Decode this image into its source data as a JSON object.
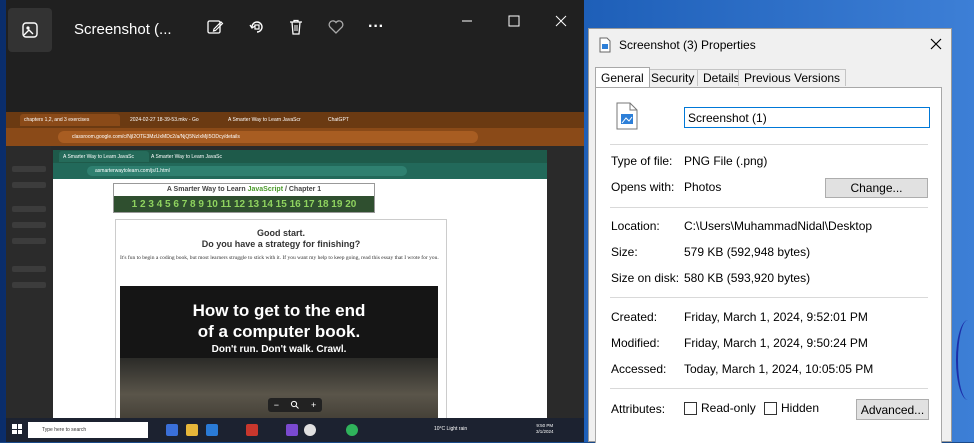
{
  "photos": {
    "title": "Screenshot (...",
    "toolbar_icons": [
      "edit-icon",
      "rotate-icon",
      "delete-icon",
      "favorite-icon",
      "more-icon"
    ],
    "more_label": "···"
  },
  "shot": {
    "browser_tabs": [
      "chapters 1,2, and 3 exercises",
      "2024-02-27 18-39-53.mkv - Go",
      "A Smarter Way to Learn JavaScr",
      "ChatGPT"
    ],
    "browser_url": "classroom.google.com/c/NjI2OTE3MzUxMDc2/a/NjQ5NzIxMjI5ODcy/details",
    "popup_tabs": [
      "A Smarter Way to Learn JavaSc",
      "A Smarter Way to Learn JavaSc"
    ],
    "popup_url": "asmarterwaytolearn.com/js/1.html",
    "header_prefix": "A Smarter Way to Learn",
    "header_js": "JavaScript",
    "header_suffix": " /  Chapter 1",
    "chapter_numbers": "1 2 3 4 5 6 7 8 9 10 11 12 13 14 15 16 17 18 19 20",
    "good_start": "Good start.",
    "strategy": "Do you have a strategy for finishing?",
    "intro": "It's fun to begin a coding book, but most learners struggle to stick with it. If you want my help to keep going, read this essay that I wrote for you.",
    "hero_title_1": "How to get to the end",
    "hero_title_2": "of a computer book.",
    "hero_sub": "Don't run. Don't walk. Crawl.",
    "zoom_minus": "−",
    "zoom_plus": "+",
    "taskbar_search": "Type here to search",
    "weather": "10°C  Light rain",
    "clock_time": "9:50 PM",
    "clock_date": "3/1/2024"
  },
  "props": {
    "title": "Screenshot (3) Properties",
    "tabs": [
      "General",
      "Security",
      "Details",
      "Previous Versions"
    ],
    "file_name": "Screenshot (1)",
    "type_label": "Type of file:",
    "type_value": "PNG File (.png)",
    "opens_label": "Opens with:",
    "opens_value": "Photos",
    "change_button": "Change...",
    "location_label": "Location:",
    "location_value": "C:\\Users\\MuhammadNidal\\Desktop",
    "size_label": "Size:",
    "size_value": "579 KB (592,948 bytes)",
    "size_disk_label": "Size on disk:",
    "size_disk_value": "580 KB (593,920 bytes)",
    "created_label": "Created:",
    "created_value": "Friday, March 1, 2024, 9:52:01 PM",
    "modified_label": "Modified:",
    "modified_value": "Friday, March 1, 2024, 9:50:24 PM",
    "accessed_label": "Accessed:",
    "accessed_value": "Today, March 1, 2024, 10:05:05 PM",
    "attributes_label": "Attributes:",
    "readonly_label": "Read-only",
    "hidden_label": "Hidden",
    "advanced_button": "Advanced..."
  }
}
